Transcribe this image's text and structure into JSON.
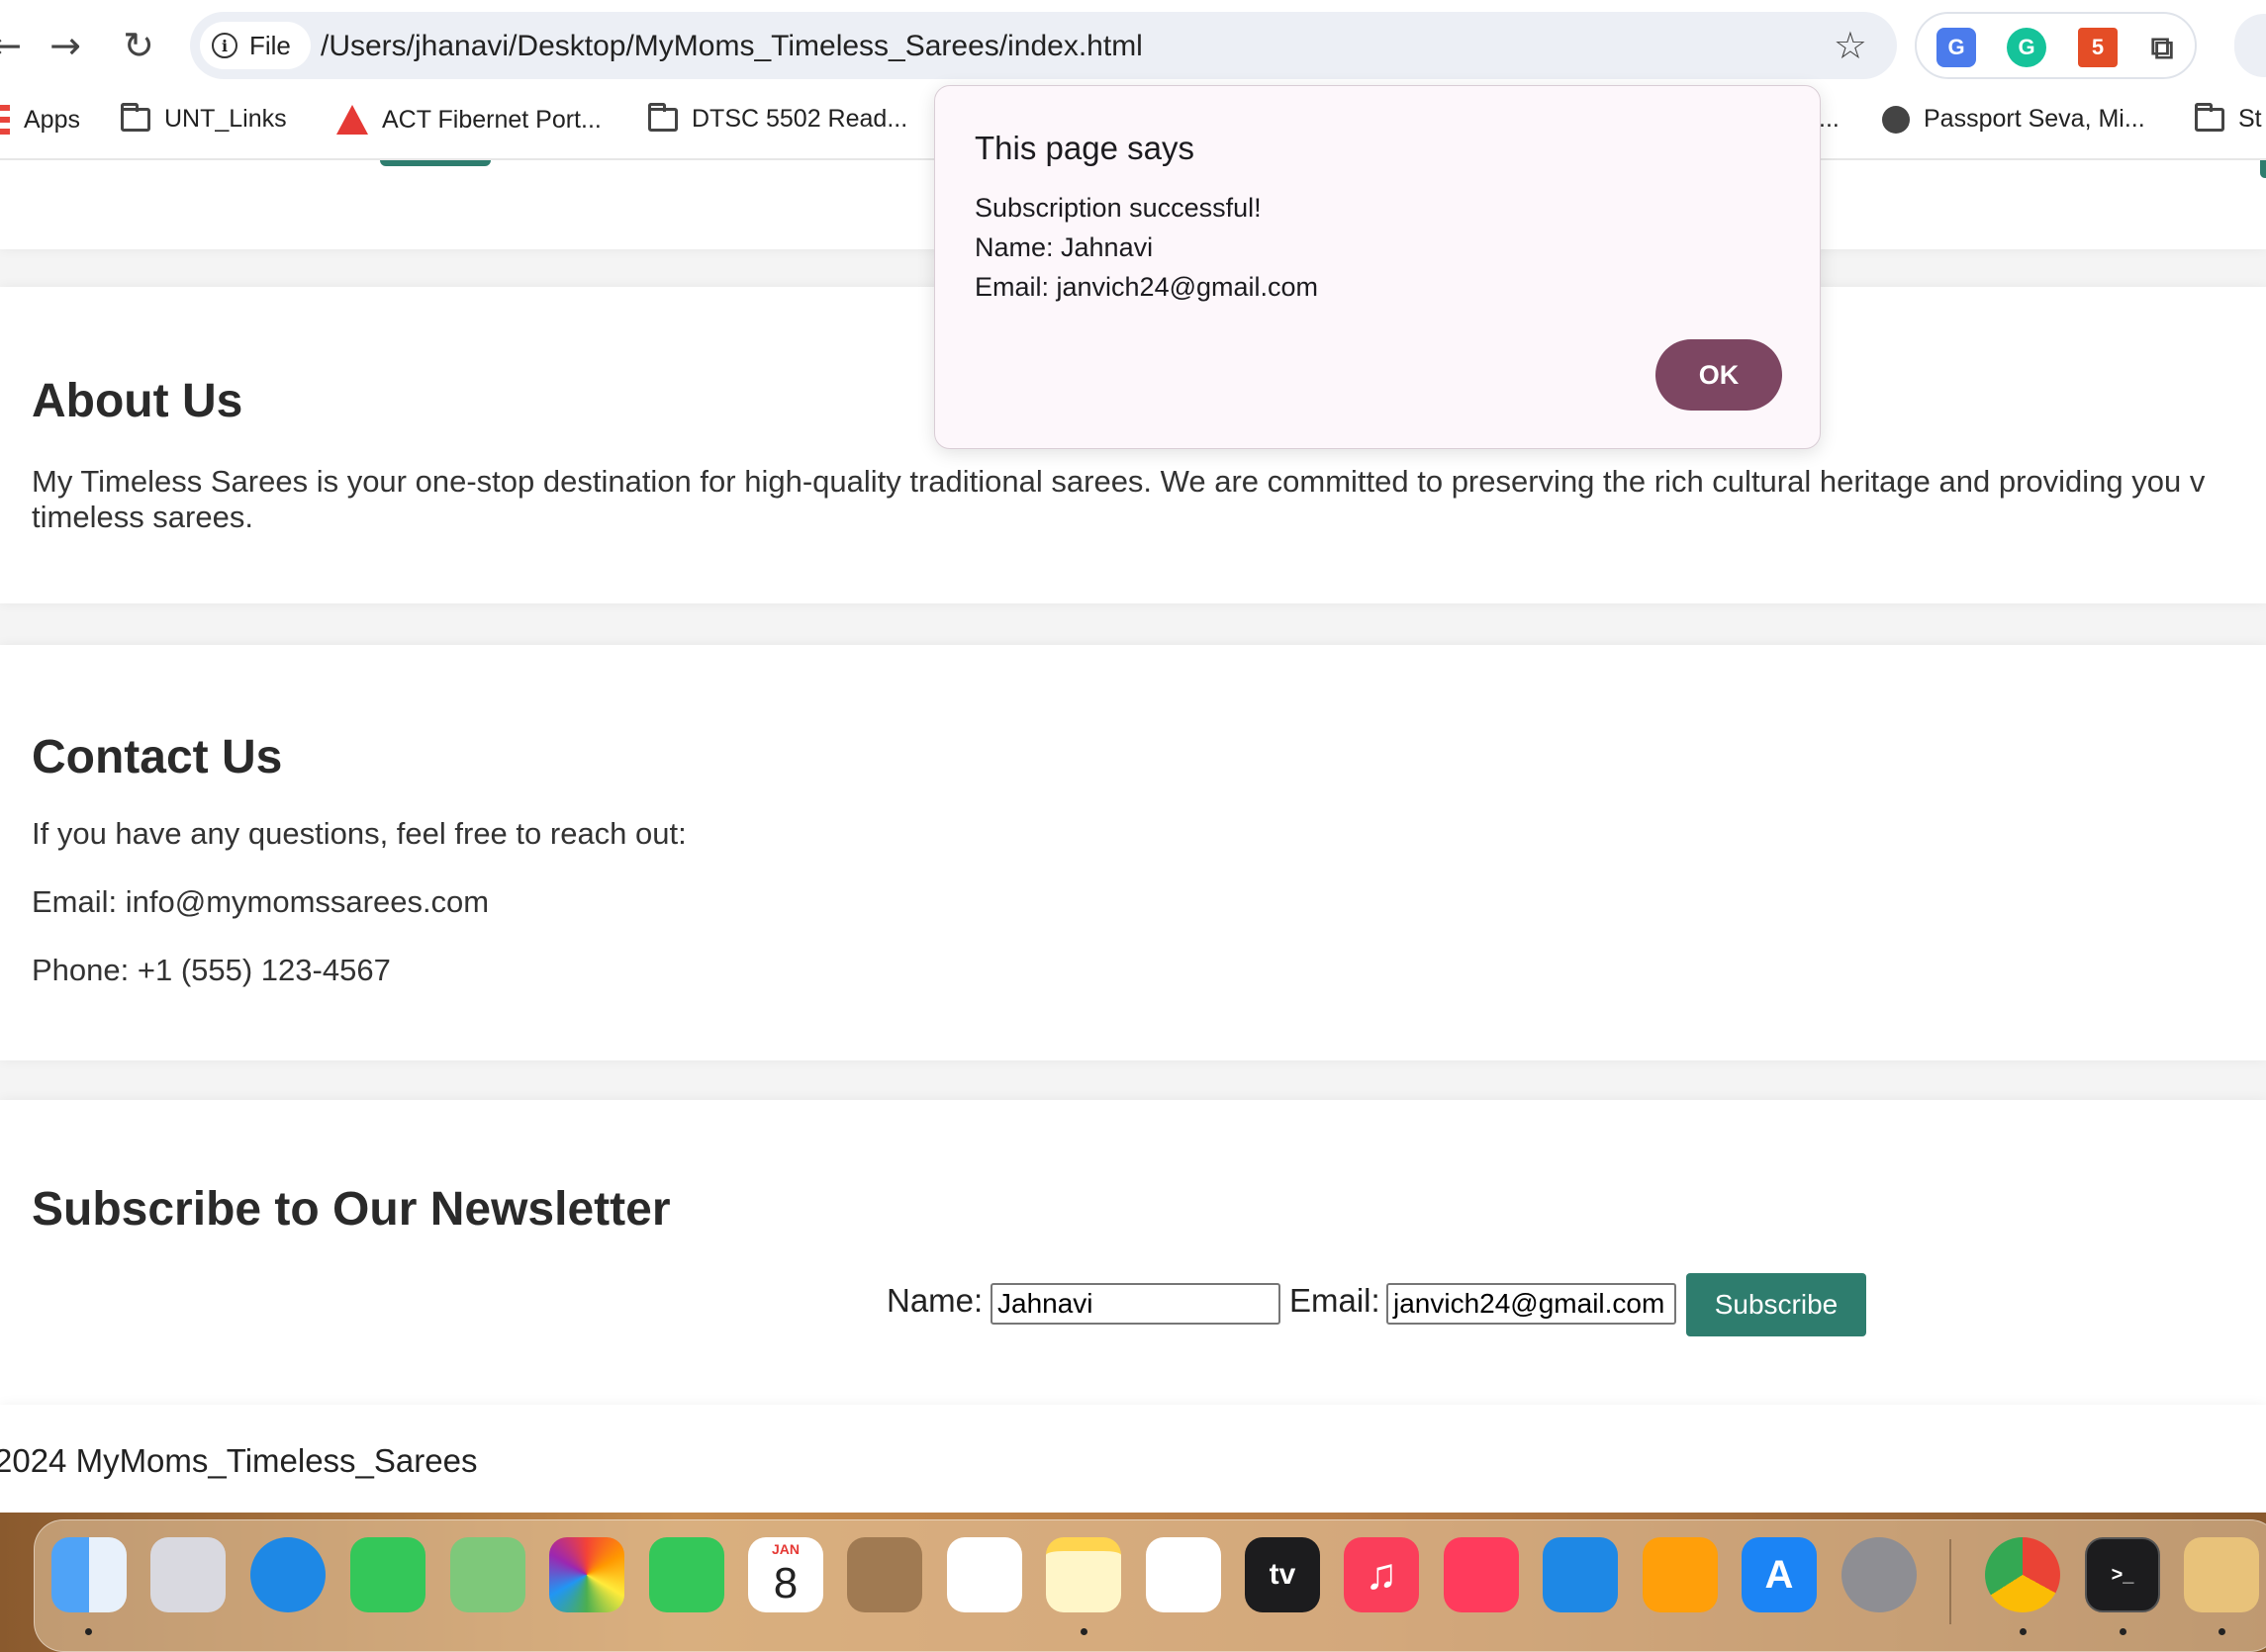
{
  "browser": {
    "back_glyph": "←",
    "forward_glyph": "→",
    "reload_glyph": "↻",
    "file_label": "File",
    "url": "/Users/jhanavi/Desktop/MyMoms_Timeless_Sarees/index.html",
    "star_glyph": "☆",
    "puzzle_glyph": "⧉"
  },
  "bookmarks": [
    {
      "label": "Apps"
    },
    {
      "label": "UNT_Links"
    },
    {
      "label": "ACT Fibernet Port..."
    },
    {
      "label": "DTSC 5502 Read..."
    },
    {
      "label": "..."
    },
    {
      "label": "Passport Seva, Mi..."
    },
    {
      "label": "St"
    }
  ],
  "dialog": {
    "title": "This page says",
    "lines": [
      "Subscription successful!",
      "Name: Jahnavi",
      "Email: janvich24@gmail.com"
    ],
    "ok_label": "OK"
  },
  "about": {
    "heading": "About Us",
    "text": "My Timeless Sarees is your one-stop destination for high-quality traditional sarees. We are committed to preserving the rich cultural heritage and providing you v",
    "text_cont": "timeless sarees."
  },
  "contact": {
    "heading": "Contact Us",
    "intro": "If you have any questions, feel free to reach out:",
    "email": "Email: info@mymomssarees.com",
    "phone": "Phone: +1 (555) 123-4567"
  },
  "newsletter": {
    "heading": "Subscribe to Our Newsletter",
    "name_label": "Name:",
    "name_value": "Jahnavi",
    "email_label": "Email:",
    "email_value": "janvich24@gmail.com",
    "subscribe_label": "Subscribe"
  },
  "footer": {
    "text": "2024 MyMoms_Timeless_Sarees"
  },
  "dock": {
    "calendar_month": "JAN",
    "calendar_day": "8",
    "tv_label": "tv"
  },
  "colors": {
    "accent_teal": "#2e7d6e",
    "dialog_button": "#7d4662",
    "dialog_bg": "#fdf7fb"
  }
}
